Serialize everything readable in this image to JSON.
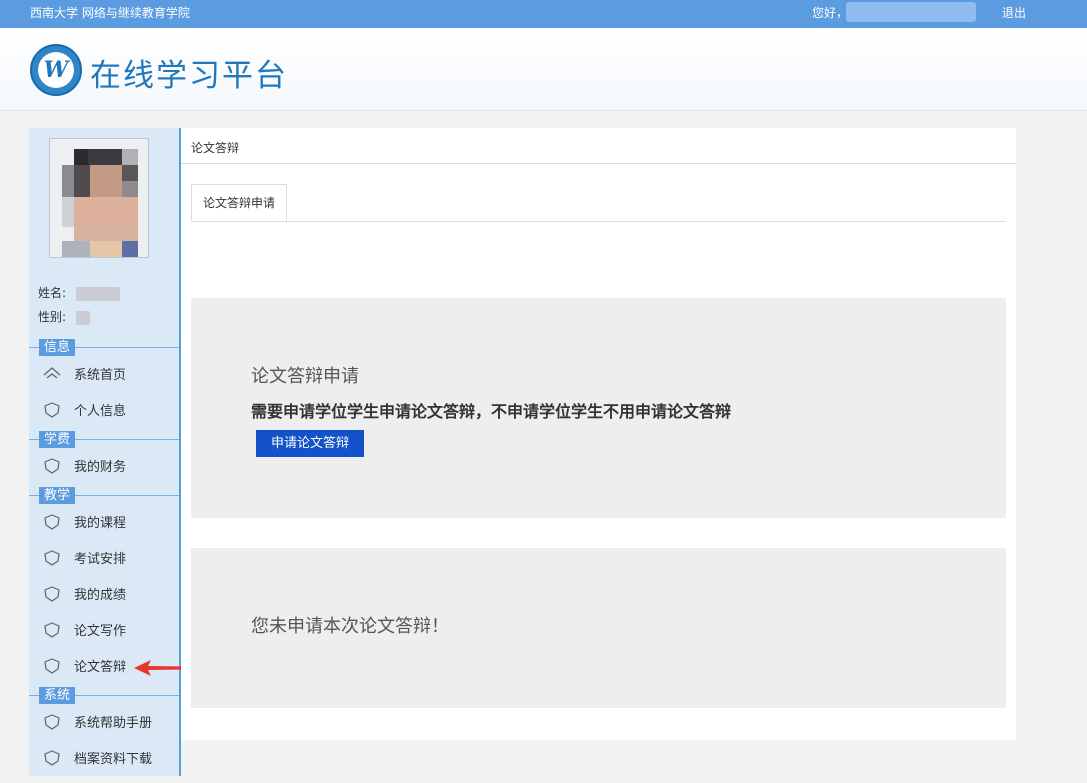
{
  "topbar": {
    "school": "西南大学 网络与继续教育学院",
    "greeting": "您好，",
    "logout": "退出"
  },
  "header": {
    "title": "在线学习平台",
    "logo_text": "W"
  },
  "profile": {
    "name_label": "姓名:",
    "gender_label": "性别:"
  },
  "sidebar": {
    "sections": [
      {
        "title": "信息",
        "items": [
          {
            "label": "系统首页",
            "icon": "home-icon"
          },
          {
            "label": "个人信息",
            "icon": "shield-icon"
          }
        ]
      },
      {
        "title": "学费",
        "items": [
          {
            "label": "我的财务",
            "icon": "shield-icon"
          }
        ]
      },
      {
        "title": "教学",
        "items": [
          {
            "label": "我的课程",
            "icon": "shield-icon"
          },
          {
            "label": "考试安排",
            "icon": "shield-icon"
          },
          {
            "label": "我的成绩",
            "icon": "shield-icon"
          },
          {
            "label": "论文写作",
            "icon": "shield-icon"
          },
          {
            "label": "论文答辩",
            "icon": "shield-icon"
          }
        ]
      },
      {
        "title": "系统",
        "items": [
          {
            "label": "系统帮助手册",
            "icon": "shield-icon"
          },
          {
            "label": "档案资料下载",
            "icon": "shield-icon"
          }
        ]
      }
    ]
  },
  "main": {
    "breadcrumb": "论文答辩",
    "tab": "论文答辩申请",
    "panel1": {
      "title": "论文答辩申请",
      "description": "需要申请学位学生申请论文答辩，不申请学位学生不用申请论文答辩",
      "button": "申请论文答辩"
    },
    "panel2": {
      "message": "您未申请本次论文答辩！"
    }
  },
  "colors": {
    "accent": "#5b9be0",
    "brand": "#1f78bd",
    "button": "#1452c9",
    "arrow": "#e8362f"
  }
}
